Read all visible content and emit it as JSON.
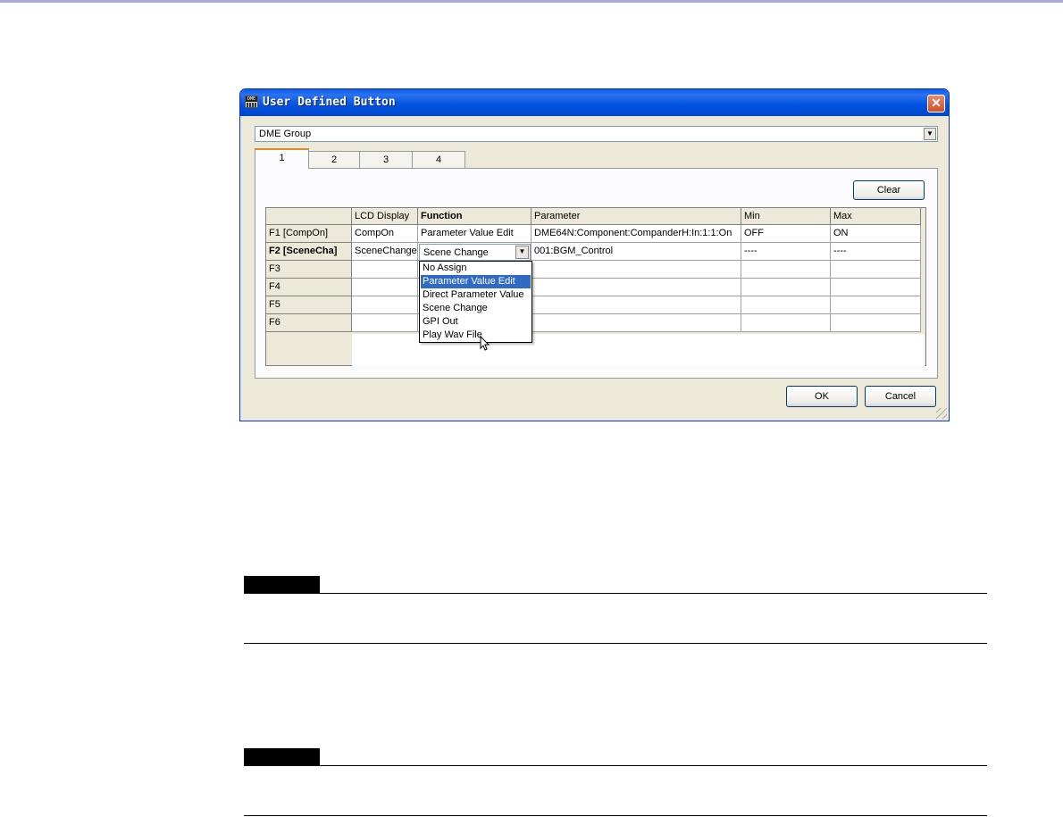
{
  "dialog": {
    "title": "User Defined Button",
    "app_icon_text": "DME",
    "close_symbol": "✕",
    "group_select": {
      "value": "DME Group"
    },
    "tabs": [
      {
        "label": "1",
        "active": true
      },
      {
        "label": "2",
        "active": false
      },
      {
        "label": "3",
        "active": false
      },
      {
        "label": "4",
        "active": false
      }
    ],
    "clear_label": "Clear",
    "ok_label": "OK",
    "cancel_label": "Cancel"
  },
  "table": {
    "columns": [
      "LCD Display",
      "Function",
      "Parameter",
      "Min",
      "Max"
    ],
    "rows": [
      {
        "key": "F1 [CompOn]",
        "lcd": "CompOn",
        "function": "Parameter Value Edit",
        "parameter": "DME64N:Component:CompanderH:In:1:1:On",
        "min": "OFF",
        "max": "ON"
      },
      {
        "key": "F2 [SceneCha]",
        "lcd": "SceneChange",
        "function": "Scene Change",
        "parameter": "001:BGM_Control",
        "min": "----",
        "max": "----"
      },
      {
        "key": "F3",
        "lcd": "",
        "function": "",
        "parameter": "",
        "min": "",
        "max": ""
      },
      {
        "key": "F4",
        "lcd": "",
        "function": "",
        "parameter": "",
        "min": "",
        "max": ""
      },
      {
        "key": "F5",
        "lcd": "",
        "function": "",
        "parameter": "",
        "min": "",
        "max": ""
      },
      {
        "key": "F6",
        "lcd": "",
        "function": "",
        "parameter": "",
        "min": "",
        "max": ""
      }
    ]
  },
  "function_dropdown": {
    "current": "Scene Change",
    "highlighted": "Parameter Value Edit",
    "options": [
      "No Assign",
      "Parameter Value Edit",
      "Direct Parameter Value",
      "Scene Change",
      "GPI Out",
      "Play Wav File"
    ]
  },
  "colors": {
    "title_bar": "#0a5ce9",
    "selection": "#316ac5",
    "tab_accent": "#e68b2c"
  }
}
